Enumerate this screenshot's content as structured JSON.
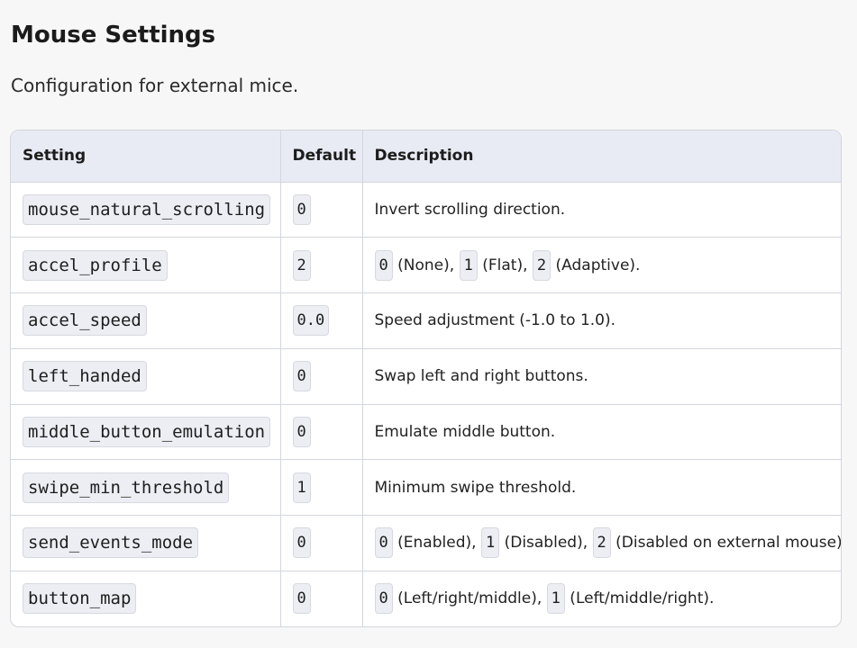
{
  "page": {
    "title": "Mouse Settings",
    "subtitle": "Configuration for external mice."
  },
  "table": {
    "headers": [
      "Setting",
      "Default",
      "Description"
    ],
    "rows": [
      {
        "setting": "mouse_natural_scrolling",
        "default": "0",
        "description": "Invert scrolling direction."
      },
      {
        "setting": "accel_profile",
        "default": "2",
        "options": [
          {
            "code": "0",
            "label": " (None), "
          },
          {
            "code": "1",
            "label": " (Flat), "
          },
          {
            "code": "2",
            "label": " (Adaptive)."
          }
        ]
      },
      {
        "setting": "accel_speed",
        "default": "0.0",
        "description": "Speed adjustment (-1.0 to 1.0)."
      },
      {
        "setting": "left_handed",
        "default": "0",
        "description": "Swap left and right buttons."
      },
      {
        "setting": "middle_button_emulation",
        "default": "0",
        "description": "Emulate middle button."
      },
      {
        "setting": "swipe_min_threshold",
        "default": "1",
        "description": "Minimum swipe threshold."
      },
      {
        "setting": "send_events_mode",
        "default": "0",
        "options": [
          {
            "code": "0",
            "label": " (Enabled), "
          },
          {
            "code": "1",
            "label": " (Disabled), "
          },
          {
            "code": "2",
            "label": " (Disabled on external mouse)."
          }
        ]
      },
      {
        "setting": "button_map",
        "default": "0",
        "options": [
          {
            "code": "0",
            "label": " (Left/right/middle), "
          },
          {
            "code": "1",
            "label": " (Left/middle/right)."
          }
        ]
      }
    ]
  }
}
